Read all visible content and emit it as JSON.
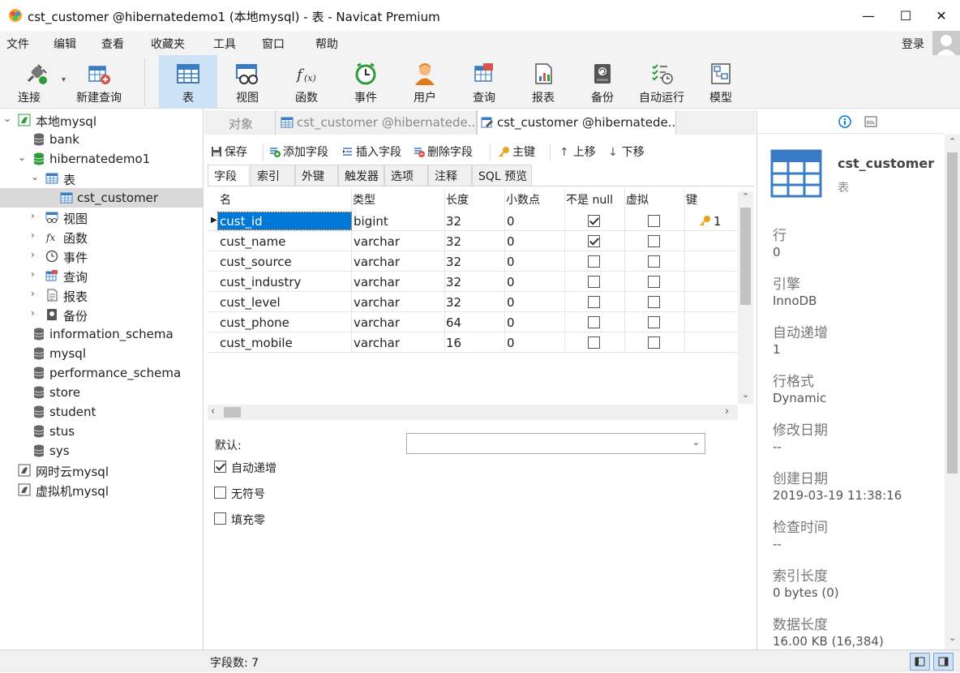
{
  "window": {
    "title": "cst_customer @hibernatedemo1 (本地mysql) - 表 - Navicat Premium",
    "minimize": "—",
    "maximize": "☐",
    "close": "✕"
  },
  "menu": {
    "items": [
      "文件",
      "编辑",
      "查看",
      "收藏夹",
      "工具",
      "窗口",
      "帮助"
    ],
    "login": "登录"
  },
  "toolbar": {
    "buttons": [
      {
        "label": "连接",
        "icon": "plug-icon"
      },
      {
        "label": "新建查询",
        "icon": "new-query-icon"
      },
      {
        "label": "表",
        "icon": "table-icon"
      },
      {
        "label": "视图",
        "icon": "view-icon"
      },
      {
        "label": "函数",
        "icon": "function-icon"
      },
      {
        "label": "事件",
        "icon": "clock-icon"
      },
      {
        "label": "用户",
        "icon": "user-icon"
      },
      {
        "label": "查询",
        "icon": "query-icon"
      },
      {
        "label": "报表",
        "icon": "report-icon"
      },
      {
        "label": "备份",
        "icon": "backup-icon"
      },
      {
        "label": "自动运行",
        "icon": "schedule-icon"
      },
      {
        "label": "模型",
        "icon": "model-icon"
      }
    ]
  },
  "nav": {
    "items": [
      {
        "label": "本地mysql",
        "level": 0,
        "expanded": true,
        "icon": "connection-icon"
      },
      {
        "label": "bank",
        "level": 1,
        "icon": "database-icon"
      },
      {
        "label": "hibernatedemo1",
        "level": 1,
        "expanded": true,
        "icon": "database-active-icon"
      },
      {
        "label": "表",
        "level": 2,
        "expanded": true,
        "icon": "table-folder-icon"
      },
      {
        "label": "cst_customer",
        "level": 3,
        "selected": true,
        "icon": "table-icon"
      },
      {
        "label": "视图",
        "level": 2,
        "icon": "view-icon"
      },
      {
        "label": "函数",
        "level": 2,
        "icon": "function-icon"
      },
      {
        "label": "事件",
        "level": 2,
        "icon": "clock-icon"
      },
      {
        "label": "查询",
        "level": 2,
        "icon": "query-icon"
      },
      {
        "label": "报表",
        "level": 2,
        "icon": "report-icon"
      },
      {
        "label": "备份",
        "level": 2,
        "icon": "backup-icon"
      },
      {
        "label": "information_schema",
        "level": 1,
        "icon": "database-icon"
      },
      {
        "label": "mysql",
        "level": 1,
        "icon": "database-icon"
      },
      {
        "label": "performance_schema",
        "level": 1,
        "icon": "database-icon"
      },
      {
        "label": "store",
        "level": 1,
        "icon": "database-icon"
      },
      {
        "label": "student",
        "level": 1,
        "icon": "database-icon"
      },
      {
        "label": "stus",
        "level": 1,
        "icon": "database-icon"
      },
      {
        "label": "sys",
        "level": 1,
        "icon": "database-icon"
      },
      {
        "label": "网时云mysql",
        "level": 0,
        "icon": "connection-icon"
      },
      {
        "label": "虚拟机mysql",
        "level": 0,
        "icon": "connection-icon"
      }
    ]
  },
  "tabs": {
    "objects": "对象",
    "tab1": "cst_customer @hibernatede...",
    "tab2": "cst_customer @hibernatede..."
  },
  "editor_toolbar": {
    "save": "保存",
    "add_field": "添加字段",
    "insert_field": "插入字段",
    "delete_field": "删除字段",
    "primary_key": "主键",
    "move_up": "上移",
    "move_down": "下移"
  },
  "subtabs": [
    "字段",
    "索引",
    "外键",
    "触发器",
    "选项",
    "注释",
    "SQL 预览"
  ],
  "grid": {
    "headers": [
      "名",
      "类型",
      "长度",
      "小数点",
      "不是 null",
      "虚拟",
      "键"
    ],
    "rows": [
      {
        "name": "cust_id",
        "type": "bigint",
        "length": "32",
        "decimals": "0",
        "not_null": true,
        "virtual": false,
        "key": "1"
      },
      {
        "name": "cust_name",
        "type": "varchar",
        "length": "32",
        "decimals": "0",
        "not_null": true,
        "virtual": false,
        "key": ""
      },
      {
        "name": "cust_source",
        "type": "varchar",
        "length": "32",
        "decimals": "0",
        "not_null": false,
        "virtual": false,
        "key": ""
      },
      {
        "name": "cust_industry",
        "type": "varchar",
        "length": "32",
        "decimals": "0",
        "not_null": false,
        "virtual": false,
        "key": ""
      },
      {
        "name": "cust_level",
        "type": "varchar",
        "length": "32",
        "decimals": "0",
        "not_null": false,
        "virtual": false,
        "key": ""
      },
      {
        "name": "cust_phone",
        "type": "varchar",
        "length": "64",
        "decimals": "0",
        "not_null": false,
        "virtual": false,
        "key": ""
      },
      {
        "name": "cust_mobile",
        "type": "varchar",
        "length": "16",
        "decimals": "0",
        "not_null": false,
        "virtual": false,
        "key": ""
      }
    ]
  },
  "props": {
    "default_label": "默认:",
    "default_value": "",
    "auto_increment": "自动递增",
    "auto_increment_checked": true,
    "unsigned": "无符号",
    "unsigned_checked": false,
    "zerofill": "填充零",
    "zerofill_checked": false
  },
  "info": {
    "title": "cst_customer",
    "subtitle": "表",
    "fields": [
      {
        "key": "行",
        "value": "0"
      },
      {
        "key": "引擎",
        "value": "InnoDB"
      },
      {
        "key": "自动递增",
        "value": "1"
      },
      {
        "key": "行格式",
        "value": "Dynamic"
      },
      {
        "key": "修改日期",
        "value": "--"
      },
      {
        "key": "创建日期",
        "value": "2019-03-19 11:38:16"
      },
      {
        "key": "检查时间",
        "value": "--"
      },
      {
        "key": "索引长度",
        "value": "0 bytes (0)"
      },
      {
        "key": "数据长度",
        "value": "16.00 KB (16,384)"
      }
    ]
  },
  "status": {
    "field_count": "字段数: 7"
  },
  "colors": {
    "accent": "#0078d7",
    "selection": "#cde2f4",
    "db_green": "#2e9b3a"
  }
}
